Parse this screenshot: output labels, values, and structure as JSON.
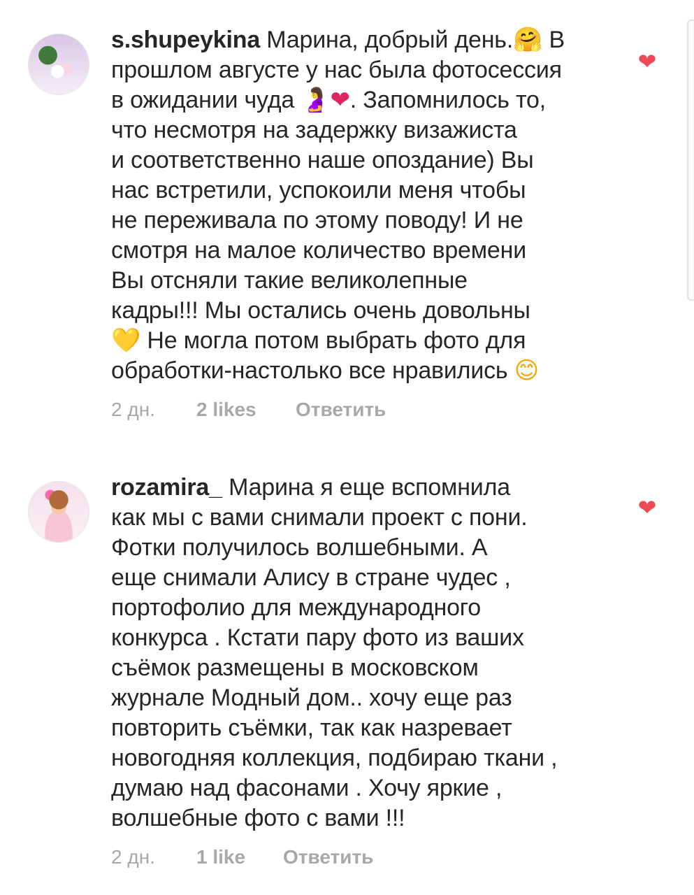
{
  "comments": [
    {
      "username": "s.shupeykina",
      "lines": [
        "Марина, добрый день.",
        "прошлом августе у нас была фотосессия",
        "в ожидании чуда",
        "что несмотря на задержку визажиста",
        "и соответственно наше опоздание) Вы",
        "нас встретили, успокоили меня чтобы",
        "не переживала по этому поводу! И не",
        "смотря на малое количество времени",
        "Вы отсняли такие великолепные",
        "кадры!!! Мы остались очень довольны",
        "Не могла потом выбрать фото для",
        "обработки-настолько все нравились"
      ],
      "line1_tail": " В",
      "line3_tail": ". Запомнилось то,",
      "emoji_hug": "🤗",
      "emoji_pregnant": "🤰",
      "emoji_red_heart": "❤",
      "emoji_yellow_heart": "💛",
      "emoji_smile": "😊",
      "time": "2 дн.",
      "likes": "2 likes",
      "reply": "Ответить"
    },
    {
      "username": "rozamira_",
      "lines": [
        " Марина я еще вспомнила",
        "как мы с вами снимали проект с пони.",
        "Фотки получилось волшебными. А",
        "еще снимали Алису в стране чудес ,",
        "портофолио для  международного",
        "конкурса . Кстати пару фото из ваших",
        "съёмок размещены в московском",
        "журнале Модный дом.. хочу еще раз",
        "повторить  съёмки, так как назревает",
        "новогодняя коллекция, подбираю ткани ,",
        "думаю над фасонами . Хочу яркие ,",
        "волшебные фото с вами !!!"
      ],
      "time": "2 дн.",
      "likes": "1 like",
      "reply": "Ответить"
    }
  ],
  "icons": {
    "like_heart": "heart-icon",
    "like_color": "#ed4956"
  }
}
